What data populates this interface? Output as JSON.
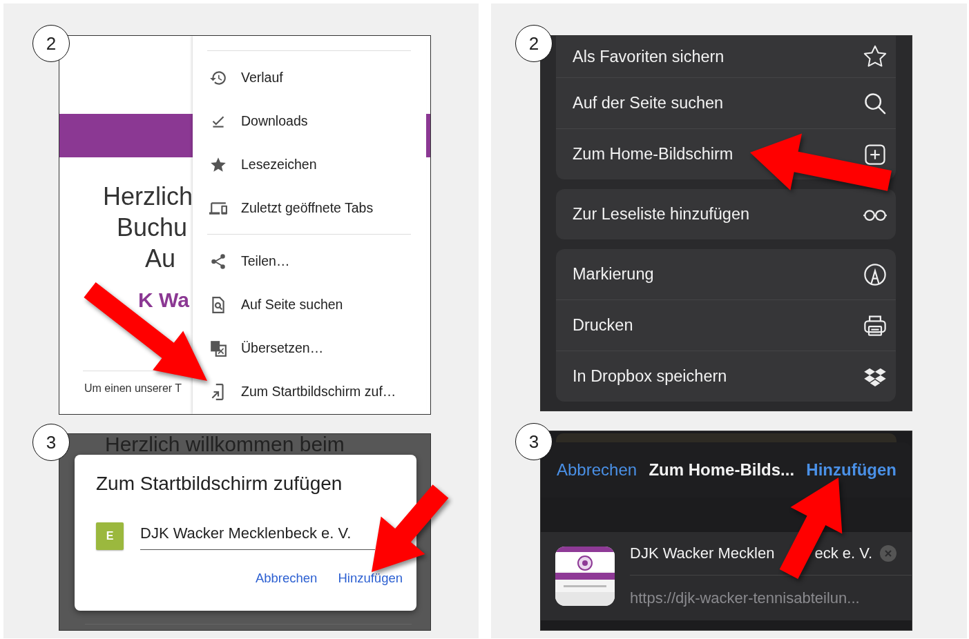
{
  "android_menu": {
    "step": "2",
    "page": {
      "heading": [
        "Herzlich",
        "Buchu",
        "Au"
      ],
      "club": "K Wa",
      "intro": "Um einen unserer T"
    },
    "groups": [
      [
        {
          "kind": "history",
          "label": "Verlauf"
        },
        {
          "kind": "download",
          "label": "Downloads"
        },
        {
          "kind": "star",
          "label": "Lesezeichen"
        },
        {
          "kind": "devices",
          "label": "Zuletzt geöffnete Tabs"
        }
      ],
      [
        {
          "kind": "share",
          "label": "Teilen…"
        },
        {
          "kind": "find",
          "label": "Auf Seite suchen"
        },
        {
          "kind": "translate",
          "label": "Übersetzen…"
        },
        {
          "kind": "addhome",
          "label": "Zum Startbildschirm zuf…"
        }
      ]
    ]
  },
  "android_dialog": {
    "step": "3",
    "background_text": "Herzlich willkommen beim",
    "title": "Zum Startbildschirm zufügen",
    "icon_letter": "E",
    "name_value": "DJK Wacker Mecklenbeck e. V.",
    "buttons": [
      "Abbrechen",
      "Hinzufügen"
    ]
  },
  "ios_menu": {
    "step": "2",
    "groups": [
      [
        {
          "kind": "star",
          "label": "Als Favoriten sichern"
        },
        {
          "kind": "search",
          "label": "Auf der Seite suchen"
        },
        {
          "kind": "plus",
          "label": "Zum Home-Bildschirm"
        }
      ],
      [
        {
          "kind": "glasses",
          "label": "Zur Leseliste hinzufügen"
        }
      ],
      [
        {
          "kind": "markup",
          "label": "Markierung"
        },
        {
          "kind": "printer",
          "label": "Drucken"
        },
        {
          "kind": "dropbox",
          "label": "In Dropbox speichern"
        }
      ]
    ]
  },
  "ios_dialog": {
    "step": "3",
    "cancel": "Abbrechen",
    "title": "Zum Home-Bilds...",
    "add": "Hinzufügen",
    "name_value": [
      "DJK Wacker Mecklen",
      "eck e. V."
    ],
    "url": "https://djk-wacker-tennisabteilun..."
  }
}
